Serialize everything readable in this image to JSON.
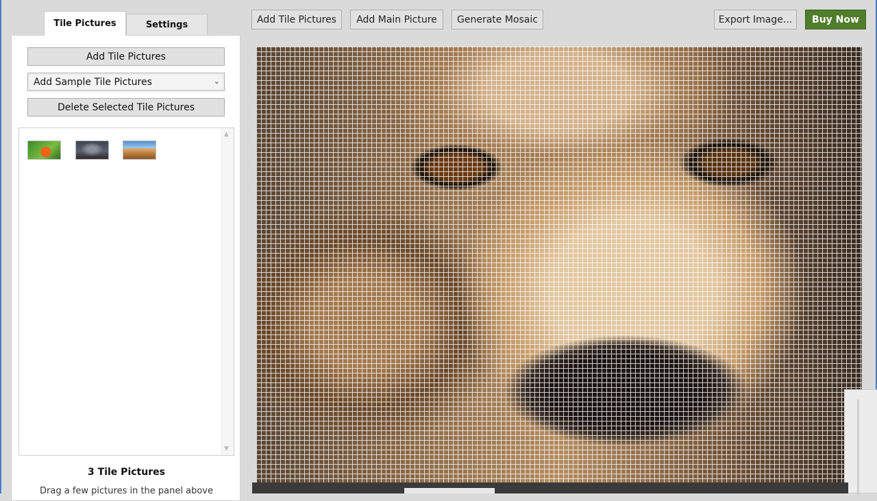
{
  "left_panel": {
    "tabs": [
      {
        "label": "Tile Pictures",
        "active": true
      },
      {
        "label": "Settings",
        "active": false
      }
    ],
    "add_tiles_label": "Add Tile Pictures",
    "sample_select": {
      "selected": "Add Sample Tile Pictures"
    },
    "delete_label": "Delete Selected Tile Pictures",
    "thumbnails": [
      "butterfly",
      "dark-landscape",
      "field-landscape"
    ],
    "count_text": "3 Tile Pictures",
    "hint_text": "Drag a few pictures in the panel above"
  },
  "toolbar": {
    "add_tiles_label": "Add Tile Pictures",
    "add_main_label": "Add Main Picture",
    "generate_label": "Generate Mosaic",
    "export_label": "Export Image...",
    "buy_label": "Buy Now"
  },
  "colors": {
    "buy_button": "#4f7d2b",
    "window_accent": "#4a7ec4",
    "background": "#dadada"
  },
  "canvas": {
    "subject": "cheetah-face-mosaic"
  }
}
